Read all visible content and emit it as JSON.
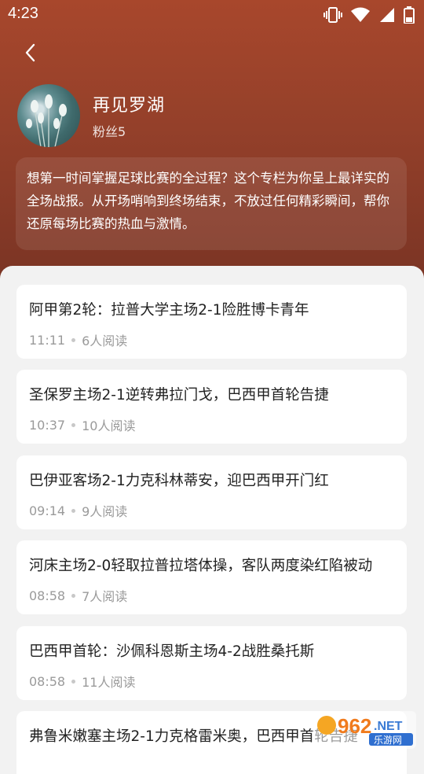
{
  "status_bar": {
    "time": "4:23"
  },
  "author": {
    "name": "再见罗湖",
    "fans": "粉丝5"
  },
  "description": "想第一时间掌握足球比赛的全过程？这个专栏为你呈上最详实的全场战报。从开场哨响到终场结束，不放过任何精彩瞬间，帮你还原每场比赛的热血与激情。",
  "articles": [
    {
      "title": "阿甲第2轮：拉普大学主场2-1险胜博卡青年",
      "time": "11:11",
      "reads": "6人阅读"
    },
    {
      "title": "圣保罗主场2-1逆转弗拉门戈，巴西甲首轮告捷",
      "time": "10:37",
      "reads": "10人阅读"
    },
    {
      "title": "巴伊亚客场2-1力克科林蒂安，迎巴西甲开门红",
      "time": "09:14",
      "reads": "9人阅读"
    },
    {
      "title": "河床主场2-0轻取拉普拉塔体操，客队两度染红陷被动",
      "time": "08:58",
      "reads": "7人阅读"
    },
    {
      "title": "巴西甲首轮：沙佩科恩斯主场4-2战胜桑托斯",
      "time": "08:58",
      "reads": "11人阅读"
    },
    {
      "title": "弗鲁米嫩塞主场2-1力克格雷米奥，巴西甲首轮告捷",
      "time": "",
      "reads": ""
    }
  ],
  "watermark": {
    "brand": "962",
    "suffix": ".NET",
    "sub": "乐游网"
  }
}
